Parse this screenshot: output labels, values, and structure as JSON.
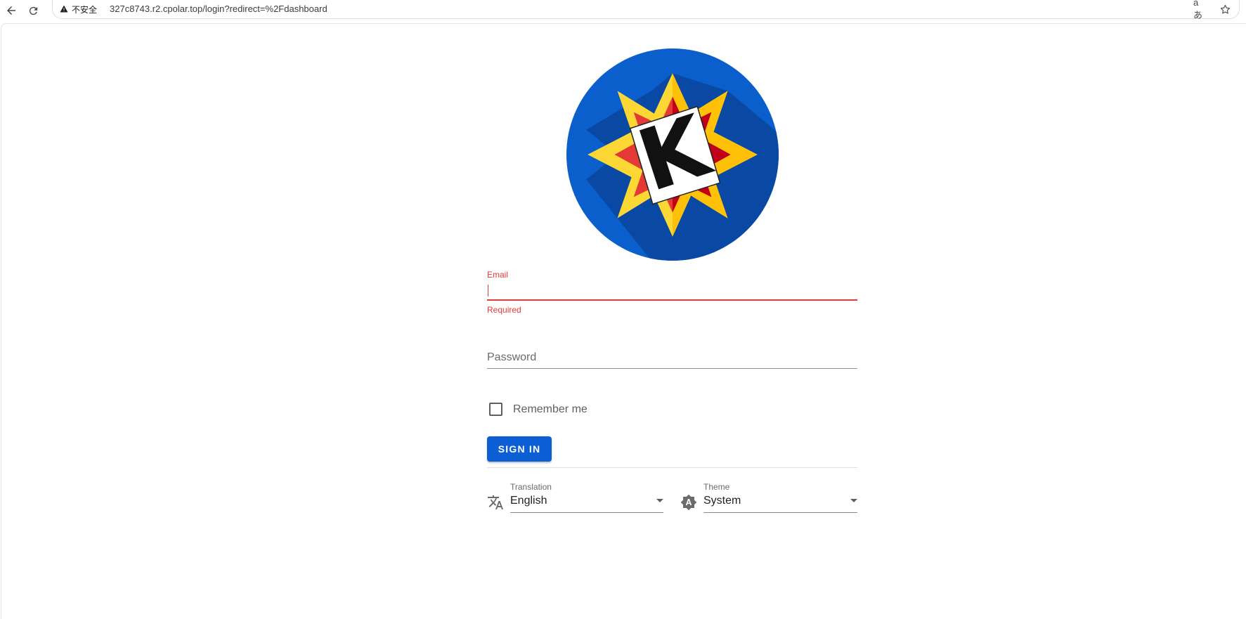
{
  "browser": {
    "security_label": "不安全",
    "url": "327c8743.r2.cpolar.top/login?redirect=%2Fdashboard",
    "translate_icon_text": "aあ",
    "icons": [
      "back-arrow-icon",
      "reload-icon",
      "warning-icon",
      "translate-icon",
      "star-icon"
    ]
  },
  "logo": {
    "letter": "K",
    "colors": {
      "circle": "#0b5fcd",
      "shadow": "#0a49a3",
      "star_outer": "#fdd835",
      "star_outer_shade": "#ffc107",
      "star_inner": "#e53935",
      "star_inner_shade": "#c00018",
      "card": "#ffffff"
    }
  },
  "form": {
    "email": {
      "label": "Email",
      "value": "",
      "helper": "Required"
    },
    "password": {
      "placeholder": "Password"
    },
    "remember_label": "Remember me",
    "remember_checked": false,
    "sign_in_label": "SIGN IN"
  },
  "settings": {
    "translation": {
      "label": "Translation",
      "value": "English",
      "icon": "translate-icon"
    },
    "theme": {
      "label": "Theme",
      "value": "System",
      "icon": "brightness-auto-icon"
    }
  },
  "colors": {
    "accent": "#0c5ed4",
    "error": "#e53935"
  }
}
